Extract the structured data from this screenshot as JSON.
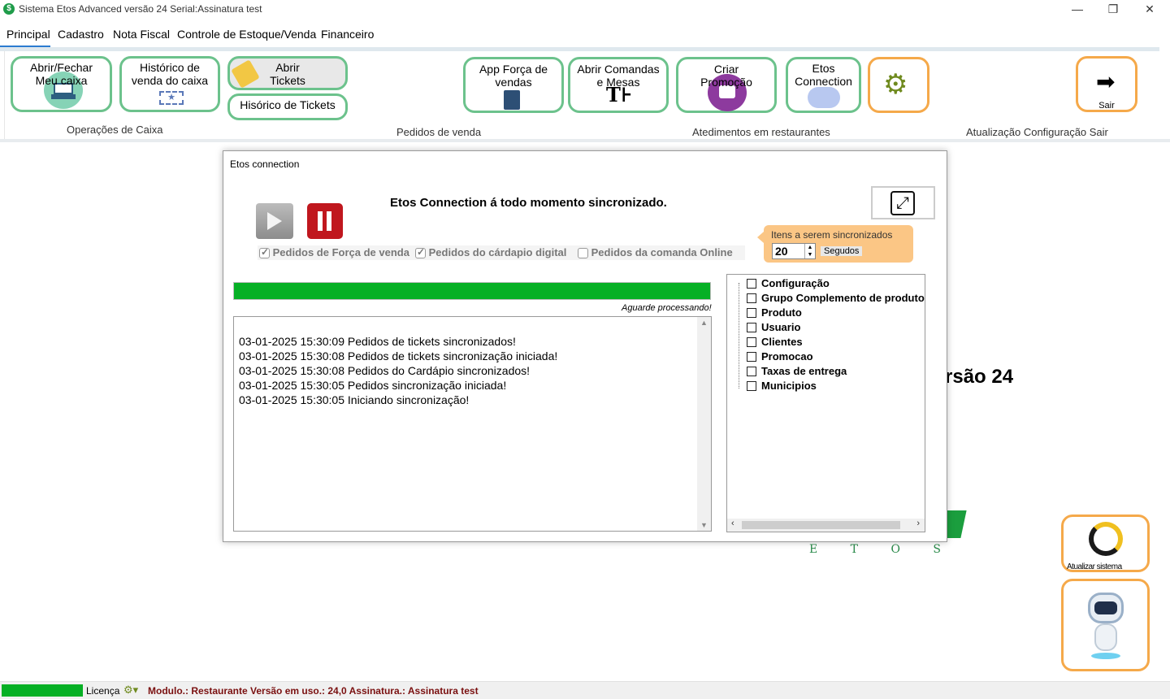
{
  "window": {
    "title": "Sistema Etos  Advanced versão 24 Serial:Assinatura test",
    "minimize": "—",
    "restore": "❐",
    "close": "✕"
  },
  "menu": [
    "Principal",
    "Cadastro",
    "Nota Fiscal",
    "Controle de Estoque/Venda",
    "Financeiro"
  ],
  "ribbon": {
    "abrir_fechar": "Abrir/Fechar\nMeu caixa",
    "historico_caixa": "Histórico de\nvenda do caixa",
    "abrir_tickets": "Abrir\nTickets",
    "historico_tickets": "Hisórico de Tickets",
    "app_forca": "App Força de\nvendas",
    "abrir_comandas": "Abrir Comandas\ne Mesas",
    "criar_promocao": "Criar\nPromoção",
    "etos_connection": "Etos\nConnection",
    "sair": "Sair",
    "groups": [
      "Operações de Caixa",
      "Pedidos de venda",
      "Atedimentos em restaurantes",
      "Atualização Configuração Sair"
    ]
  },
  "background": {
    "version_text": "rsão 24",
    "etos_brand": "E T O S",
    "atualizar_sistema": "Atualizar sistema"
  },
  "dialog": {
    "title": "Etos connection",
    "heading": "Etos Connection á todo momento sincronizado.",
    "options": [
      {
        "label": "Pedidos de Força de venda",
        "checked": true
      },
      {
        "label": "Pedidos do cárdapio digital",
        "checked": true
      },
      {
        "label": "Pedidos da comanda Online",
        "checked": false
      }
    ],
    "sync_label": "Itens a serem sincronizados",
    "sync_value": "20",
    "sync_unit": "Segudos",
    "progress_status": "Aguarde processando!",
    "progress_fraction": 1.0,
    "log": [
      "03-01-2025 15:30:09 Pedidos de tickets sincronizados!",
      "03-01-2025 15:30:08 Pedidos de tickets sincronização iniciada!",
      "03-01-2025 15:30:08 Pedidos do Cardápio sincronizados!",
      "03-01-2025 15:30:05 Pedidos sincronização iniciada!",
      "03-01-2025 15:30:05 Iniciando sincronização!"
    ],
    "tree": [
      "Configuração",
      "Grupo Complemento de produto",
      "Produto",
      "Usuario",
      "Clientes",
      "Promocao",
      "Taxas de entrega",
      "Municipios"
    ]
  },
  "status": {
    "licenca": "Licença",
    "info": "Modulo.: Restaurante Versão em uso.: 24,0 Assinatura.: Assinatura test"
  },
  "colors": {
    "accent_green": "#00a82d",
    "button_border": "#6cc28c",
    "orange": "#f5a94a",
    "status_text": "#7a1010"
  }
}
